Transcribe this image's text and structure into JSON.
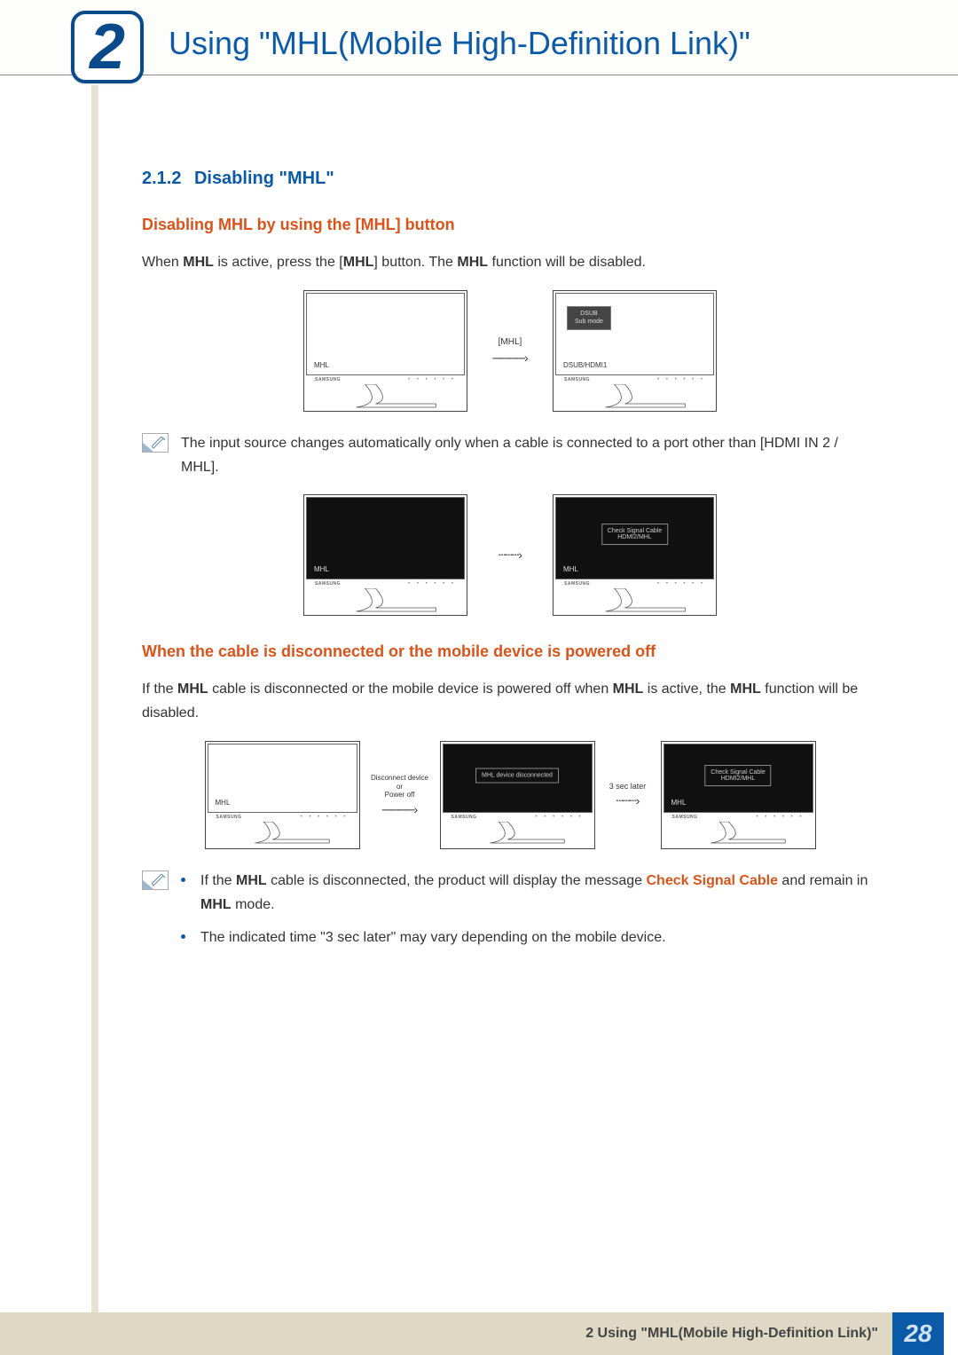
{
  "chapter": {
    "number": "2",
    "title": "Using \"MHL(Mobile High-Definition Link)\""
  },
  "section": {
    "number": "2.1.2",
    "title": "Disabling \"MHL\""
  },
  "subheading1": "Disabling MHL by using the [MHL] button",
  "paragraph1": {
    "pre": "When ",
    "b1": "MHL",
    "mid1": " is active, press the [",
    "b2": "MHL",
    "mid2": "] button. The ",
    "b3": "MHL",
    "post": " function will be disabled."
  },
  "diagram1": {
    "left_label": "MHL",
    "arrow_caption": "[MHL]",
    "right_badge": "DSUB\nSub mode",
    "right_label": "DSUB/HDMI1",
    "brand": "SAMSUNG"
  },
  "note1": "The input source changes automatically only when a cable is connected to a port other than [HDMI IN 2 / MHL].",
  "diagram2": {
    "left_label": "MHL",
    "right_badge": "Check Signal Cable\nHDMI2/MHL",
    "right_label": "MHL",
    "brand": "SAMSUNG"
  },
  "subheading2": "When the cable is disconnected or the mobile device is powered off",
  "paragraph2": {
    "pre": "If the ",
    "b1": "MHL",
    "mid1": " cable is disconnected or the mobile device is powered off when ",
    "b2": "MHL",
    "mid2": " is active, the ",
    "b3": "MHL",
    "post": " function will be disabled."
  },
  "diagram3": {
    "m1_label": "MHL",
    "arrow1_caption": "Disconnect device\nor\nPower off",
    "m2_badge": "MHL device disconnected",
    "arrow2_caption": "3 sec later",
    "m3_badge": "Check Signal Cable\nHDMI2/MHL",
    "m3_label": "MHL",
    "brand": "SAMSUNG"
  },
  "note2": {
    "bullet1_pre": "If the ",
    "bullet1_b1": "MHL",
    "bullet1_mid": " cable is disconnected, the product will display the message ",
    "bullet1_orange": "Check Signal Cable",
    "bullet1_mid2": " and remain in ",
    "bullet1_b2": "MHL",
    "bullet1_post": " mode.",
    "bullet2": "The indicated time \"3 sec later\" may vary depending on the mobile device."
  },
  "footer": {
    "label": "2 Using \"MHL(Mobile High-Definition Link)\"",
    "page": "28"
  }
}
